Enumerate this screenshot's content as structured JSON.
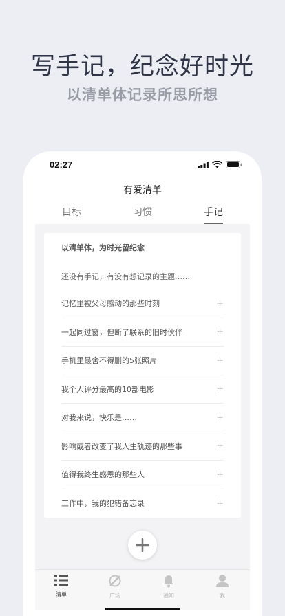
{
  "headline": "写手记，纪念好时光",
  "subline": "以清单体记录所思所想",
  "status": {
    "time": "02:27"
  },
  "app": {
    "title": "有爱清单"
  },
  "tabs": [
    {
      "label": "目标"
    },
    {
      "label": "习惯"
    },
    {
      "label": "手记",
      "active": true
    }
  ],
  "card": {
    "title": "以清单体，为时光留纪念",
    "intro": "还没有手记，有没有想记录的主题……",
    "items": [
      {
        "label": "记忆里被父母感动的那些时刻",
        "action": "+"
      },
      {
        "label": "一起同过窗，但断了联系的旧时伙伴",
        "action": "+"
      },
      {
        "label": "手机里最舍不得删的5张照片",
        "action": "+"
      },
      {
        "label": "我个人评分最高的10部电影",
        "action": "+"
      },
      {
        "label": "对我来说，快乐是……",
        "action": "+"
      },
      {
        "label": "影响或者改变了我人生轨迹的那些事",
        "action": "+"
      },
      {
        "label": "值得我终生感恩的那些人",
        "action": "+"
      },
      {
        "label": "工作中，我的犯错备忘录",
        "action": "+"
      }
    ]
  },
  "tabbar": [
    {
      "label": "清单",
      "icon": "list-icon",
      "active": true
    },
    {
      "label": "广场",
      "icon": "compass-icon"
    },
    {
      "label": "通知",
      "icon": "bell-icon"
    },
    {
      "label": "我",
      "icon": "user-icon"
    }
  ],
  "colors": {
    "background": "#eceef4",
    "headline": "#2f3446",
    "subline": "#9a9da6"
  }
}
